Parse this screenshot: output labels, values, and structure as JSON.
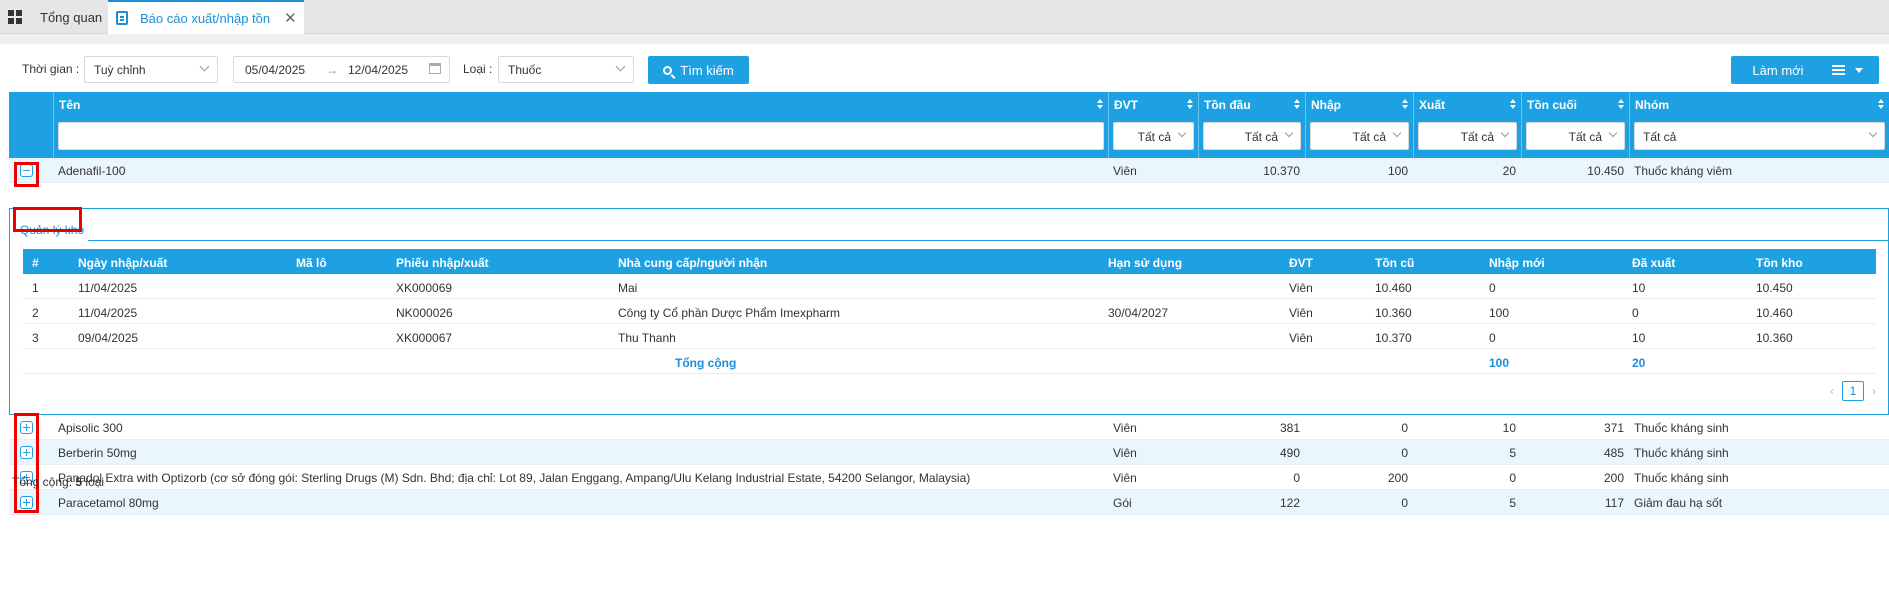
{
  "tabs": [
    {
      "label": "Tổng quan"
    },
    {
      "label": "Báo cáo xuất/nhập tồn"
    }
  ],
  "filters": {
    "time_label": "Thời gian :",
    "time_value": "Tuỳ chỉnh",
    "date_from": "05/04/2025",
    "date_to": "12/04/2025",
    "arrow": "→",
    "type_label": "Loại :",
    "type_value": "Thuốc",
    "search_label": "Tìm kiếm",
    "refresh_label": "Làm mới"
  },
  "columns": {
    "name": "Tên",
    "unit": "ĐVT",
    "opening": "Tồn đầu",
    "import": "Nhập",
    "export": "Xuất",
    "closing": "Tồn cuối",
    "group": "Nhóm",
    "filter_all": "Tất cả"
  },
  "rows": [
    {
      "name": "Adenafil-100",
      "unit": "Viên",
      "opening": "10.370",
      "import": "100",
      "export": "20",
      "closing": "10.450",
      "group": "Thuốc kháng viêm"
    },
    {
      "name": "Apisolic 300",
      "unit": "Viên",
      "opening": "381",
      "import": "0",
      "export": "10",
      "closing": "371",
      "group": "Thuốc kháng sinh"
    },
    {
      "name": "Berberin 50mg",
      "unit": "Viên",
      "opening": "490",
      "import": "0",
      "export": "5",
      "closing": "485",
      "group": "Thuốc kháng sinh"
    },
    {
      "name": "Panadol Extra with Optizorb (cơ sở đóng gói: Sterling Drugs (M) Sdn. Bhd; địa chỉ: Lot 89, Jalan Enggang, Ampang/Ulu Kelang Industrial Estate, 54200 Selangor, Malaysia)",
      "unit": "Viên",
      "opening": "0",
      "import": "200",
      "export": "0",
      "closing": "200",
      "group": "Thuốc kháng sinh"
    },
    {
      "name": "Paracetamol 80mg",
      "unit": "Gói",
      "opening": "122",
      "import": "0",
      "export": "5",
      "closing": "117",
      "group": "Giảm đau hạ sốt"
    }
  ],
  "detail": {
    "tab_label": "Quản lý kho",
    "headers": {
      "idx": "#",
      "date": "Ngày nhập/xuất",
      "lot": "Mã lô",
      "slip": "Phiếu nhập/xuất",
      "partner": "Nhà cung cấp/người nhận",
      "expiry": "Hạn sử dụng",
      "unit": "ĐVT",
      "old": "Tồn cũ",
      "new_in": "Nhập mới",
      "out": "Đã xuất",
      "stock": "Tồn kho"
    },
    "rows": [
      {
        "idx": "1",
        "date": "11/04/2025",
        "lot": "",
        "slip": "XK000069",
        "partner": "Mai",
        "expiry": "",
        "unit": "Viên",
        "old": "10.460",
        "new_in": "0",
        "out": "10",
        "stock": "10.450"
      },
      {
        "idx": "2",
        "date": "11/04/2025",
        "lot": "",
        "slip": "NK000026",
        "partner": "Công ty Cổ phần Dược Phẩm Imexpharm",
        "expiry": "30/04/2027",
        "unit": "Viên",
        "old": "10.360",
        "new_in": "100",
        "out": "0",
        "stock": "10.460"
      },
      {
        "idx": "3",
        "date": "09/04/2025",
        "lot": "",
        "slip": "XK000067",
        "partner": "Thu Thanh",
        "expiry": "",
        "unit": "Viên",
        "old": "10.370",
        "new_in": "0",
        "out": "10",
        "stock": "10.360"
      }
    ],
    "total_label": "Tổng cộng",
    "total_in": "100",
    "total_out": "20",
    "page": "1",
    "prev": "‹",
    "next": "›"
  },
  "footer": {
    "label": "Tổng cộng:",
    "count": "5",
    "unit": "loại"
  },
  "colors": {
    "primary": "#1da1e2",
    "row_alt": "#eaf6fd",
    "highlight": "#ee0000"
  }
}
